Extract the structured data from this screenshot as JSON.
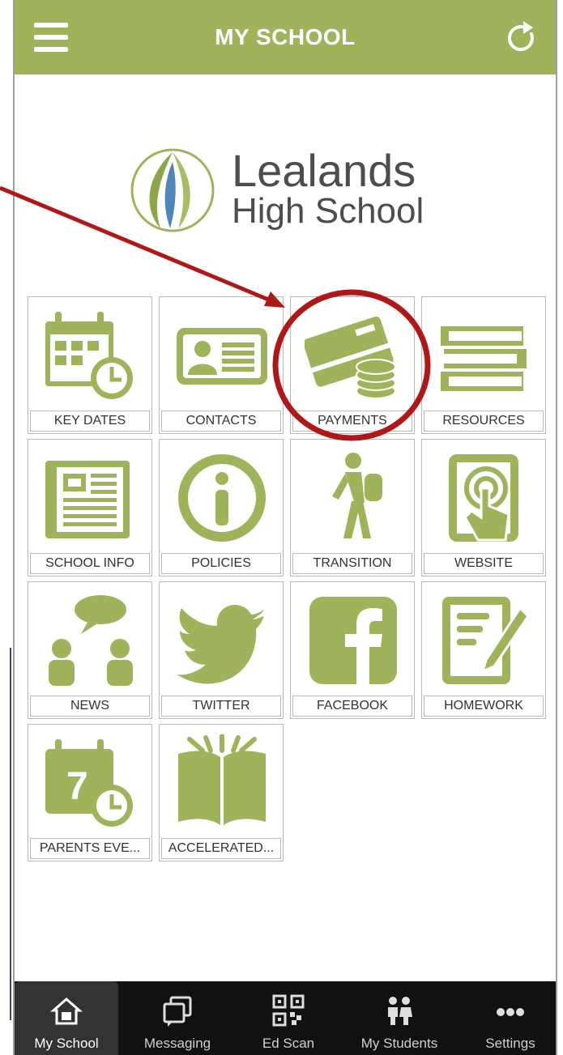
{
  "header": {
    "title": "MY SCHOOL",
    "menu_icon": "hamburger-menu-icon",
    "refresh_icon": "refresh-icon"
  },
  "logo": {
    "line1": "Lealands",
    "line2": "High School"
  },
  "colors": {
    "brand": "#9fb35a",
    "annotation": "#b01818",
    "tabbar": "#111111"
  },
  "tiles": [
    {
      "label": "KEY DATES",
      "icon": "calendar-clock-icon"
    },
    {
      "label": "CONTACTS",
      "icon": "contact-card-icon"
    },
    {
      "label": "PAYMENTS",
      "icon": "credit-card-coins-icon"
    },
    {
      "label": "RESOURCES",
      "icon": "books-icon"
    },
    {
      "label": "SCHOOL INFO",
      "icon": "newspaper-icon"
    },
    {
      "label": "POLICIES",
      "icon": "info-icon"
    },
    {
      "label": "TRANSITION",
      "icon": "walking-student-icon"
    },
    {
      "label": "WEBSITE",
      "icon": "tablet-touch-icon"
    },
    {
      "label": "NEWS",
      "icon": "people-chat-icon"
    },
    {
      "label": "TWITTER",
      "icon": "twitter-bird-icon"
    },
    {
      "label": "FACEBOOK",
      "icon": "facebook-icon"
    },
    {
      "label": "HOMEWORK",
      "icon": "homework-pencil-icon"
    },
    {
      "label": "PARENTS EVE...",
      "icon": "calendar-seven-icon"
    },
    {
      "label": "ACCELERATED...",
      "icon": "open-book-icon"
    }
  ],
  "tabs": [
    {
      "label": "My School",
      "icon": "home-icon",
      "active": true
    },
    {
      "label": "Messaging",
      "icon": "messages-icon",
      "active": false
    },
    {
      "label": "Ed Scan",
      "icon": "qr-code-icon",
      "active": false
    },
    {
      "label": "My Students",
      "icon": "children-icon",
      "active": false
    },
    {
      "label": "Settings",
      "icon": "more-dots-icon",
      "active": false
    }
  ]
}
